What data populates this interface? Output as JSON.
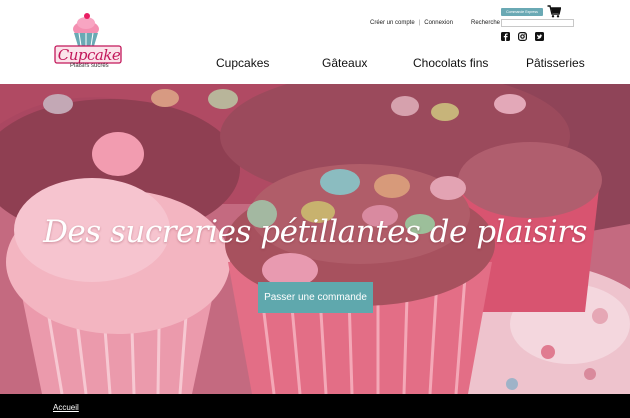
{
  "brand": {
    "name": "Cupcake",
    "tagline": "Plaisirs sucrés",
    "accent": "#c2185b"
  },
  "account": {
    "create_label": "Créer un compte",
    "separator": "|",
    "login_label": "Connexion"
  },
  "order_tracking": {
    "label": "Commande Express"
  },
  "search": {
    "label": "Recherche",
    "value": "",
    "placeholder": ""
  },
  "icons": {
    "cart": "cart-icon",
    "social": [
      "facebook-icon",
      "instagram-icon",
      "twitter-icon"
    ]
  },
  "nav": {
    "items": [
      {
        "label": "Cupcakes"
      },
      {
        "label": "Gâteaux"
      },
      {
        "label": "Chocolats fins"
      },
      {
        "label": "Pâtisseries"
      }
    ]
  },
  "hero": {
    "title": "Des sucreries pétillantes de plaisirs",
    "cta_label": "Passer une commande",
    "cta_color": "#5fa8ad"
  },
  "footer": {
    "link_label": "Accueil",
    "background": "#000000"
  }
}
